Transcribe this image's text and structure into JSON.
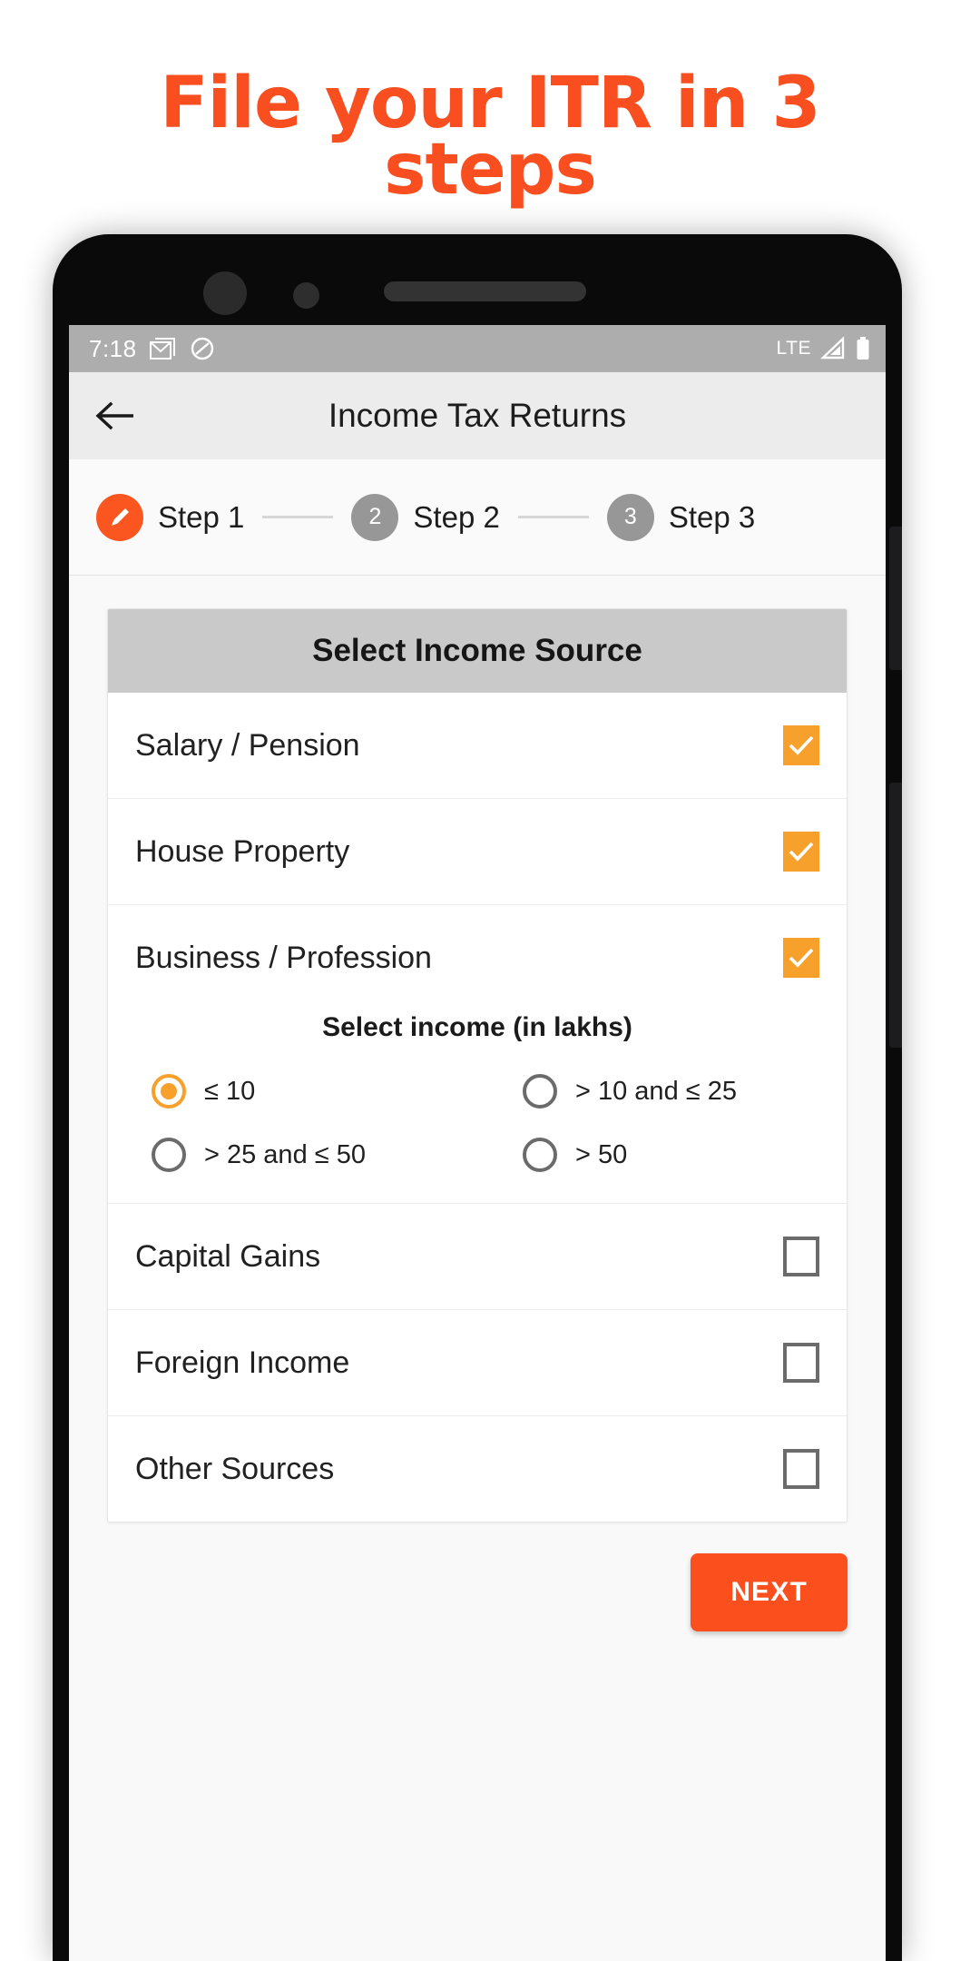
{
  "promo": {
    "heading_line1": "File your ITR in 3",
    "heading_line2": "steps",
    "heading_color": "#F84E20"
  },
  "status_bar": {
    "time": "7:18",
    "icons_left": [
      "gmail-icon",
      "do-not-disturb-icon"
    ],
    "network_label": "LTE",
    "icons_right": [
      "signal-icon",
      "battery-icon"
    ],
    "background_color": "#ADADAD"
  },
  "app_bar": {
    "back_icon": "back-arrow-icon",
    "title": "Income Tax Returns"
  },
  "stepper": {
    "steps": [
      {
        "marker": "pencil-icon",
        "number": "1",
        "label": "Step 1",
        "state": "active",
        "color": "#FB5620"
      },
      {
        "marker": "number",
        "number": "2",
        "label": "Step 2",
        "state": "inactive",
        "color": "#979797"
      },
      {
        "marker": "number",
        "number": "3",
        "label": "Step 3",
        "state": "inactive",
        "color": "#979797"
      }
    ]
  },
  "card": {
    "header": "Select Income Source",
    "rows": [
      {
        "label": "Salary / Pension",
        "checked": true
      },
      {
        "label": "House Property",
        "checked": true
      },
      {
        "label": "Business / Profession",
        "checked": true
      },
      {
        "label": "Capital Gains",
        "checked": false
      },
      {
        "label": "Foreign Income",
        "checked": false
      },
      {
        "label": "Other Sources",
        "checked": false
      }
    ],
    "sub_panel": {
      "title": "Select income (in lakhs)",
      "options": [
        {
          "label": "≤ 10",
          "selected": true
        },
        {
          "label": "> 10 and ≤ 25",
          "selected": false
        },
        {
          "label": "> 25 and ≤ 50",
          "selected": false
        },
        {
          "label": "> 50",
          "selected": false
        }
      ]
    }
  },
  "footer": {
    "next_label": "NEXT",
    "next_color": "#FB4F1E"
  },
  "colors": {
    "accent_orange": "#FB5620",
    "checkbox_orange": "#F7A02C",
    "card_header_grey": "#C9C9C9"
  }
}
